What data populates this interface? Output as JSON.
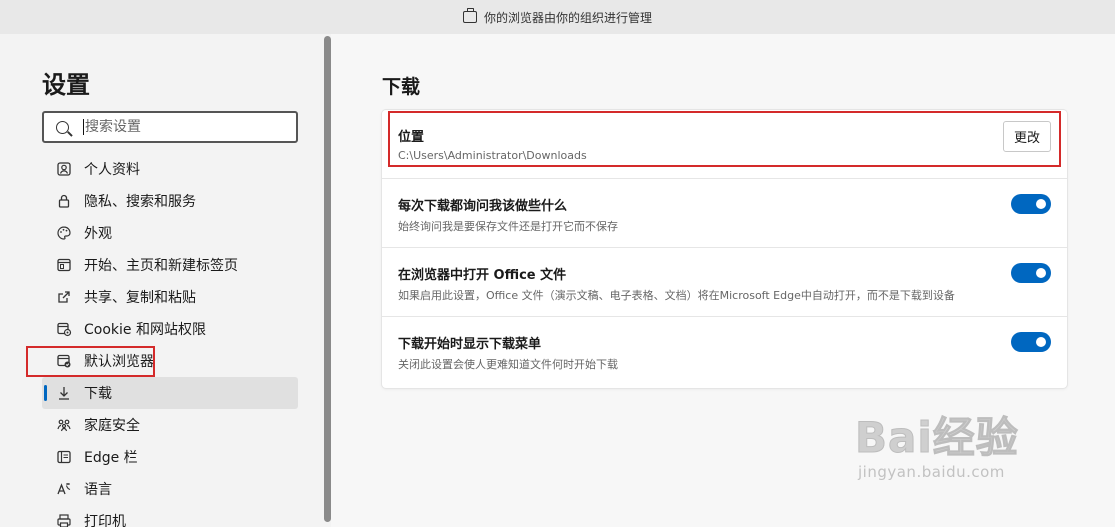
{
  "banner": {
    "text": "你的浏览器由你的组织进行管理",
    "icon": "briefcase-icon"
  },
  "sidebar": {
    "title": "设置",
    "search_placeholder": "搜索设置",
    "items": [
      {
        "label": "个人资料",
        "icon": "profile-icon"
      },
      {
        "label": "隐私、搜索和服务",
        "icon": "lock-icon"
      },
      {
        "label": "外观",
        "icon": "palette-icon"
      },
      {
        "label": "开始、主页和新建标签页",
        "icon": "home-tabs-icon"
      },
      {
        "label": "共享、复制和粘贴",
        "icon": "share-icon"
      },
      {
        "label": "Cookie 和网站权限",
        "icon": "cookie-icon"
      },
      {
        "label": "默认浏览器",
        "icon": "browser-icon"
      },
      {
        "label": "下载",
        "icon": "download-icon",
        "active": true
      },
      {
        "label": "家庭安全",
        "icon": "family-icon"
      },
      {
        "label": "Edge 栏",
        "icon": "sidebar-panel-icon"
      },
      {
        "label": "语言",
        "icon": "language-icon"
      },
      {
        "label": "打印机",
        "icon": "printer-icon"
      }
    ]
  },
  "main": {
    "title": "下载",
    "location": {
      "title": "位置",
      "path": "C:\\Users\\Administrator\\Downloads",
      "button": "更改"
    },
    "settings": [
      {
        "title": "每次下载都询问我该做些什么",
        "description": "始终询问我是要保存文件还是打开它而不保存",
        "enabled": true
      },
      {
        "title": "在浏览器中打开 Office 文件",
        "description": "如果启用此设置，Office 文件（演示文稿、电子表格、文档）将在Microsoft Edge中自动打开，而不是下载到设备",
        "enabled": true
      },
      {
        "title": "下载开始时显示下载菜单",
        "description": "关闭此设置会使人更难知道文件何时开始下载",
        "enabled": true
      }
    ]
  },
  "watermark": {
    "main": "Bai经验",
    "sub": "jingyan.baidu.com"
  },
  "colors": {
    "accent": "#0067c0",
    "highlight": "#d42a2a"
  }
}
